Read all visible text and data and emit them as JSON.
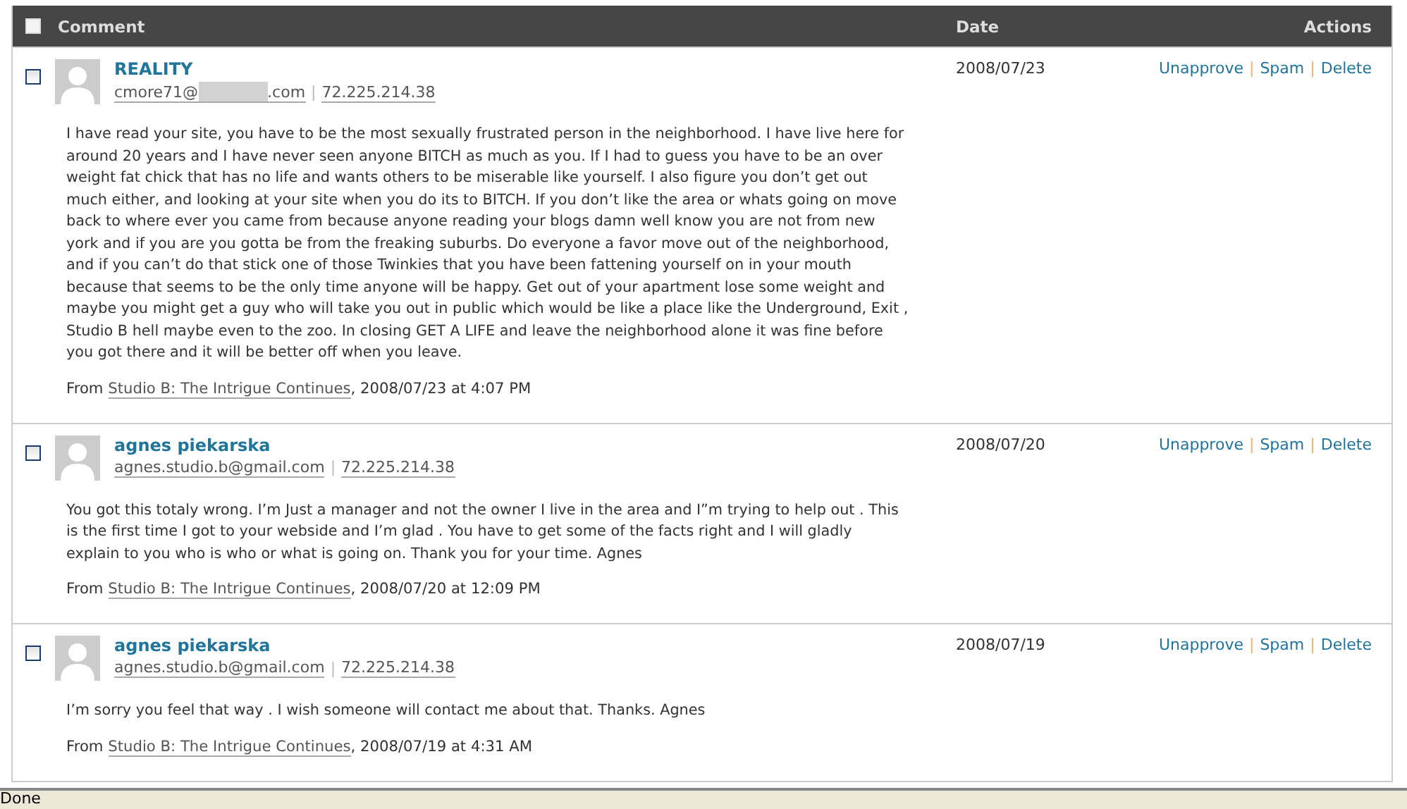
{
  "table": {
    "select_all": {
      "checked": false
    },
    "columns": [
      "Comment",
      "Date",
      "Actions"
    ],
    "rows": [
      {
        "checked": false,
        "author": "REALITY",
        "contact": {
          "email_start": "cmore71@",
          "email_redacted": true,
          "email_end": ".com",
          "separator": "|",
          "ip": "72.225.214.38"
        },
        "body": "I have read your site, you have to be the most sexually frustrated person in the neighborhood. I have live here for around 20 years and I have never seen anyone BITCH as much as you. If I had to guess you have to be an over weight fat chick that has no life and wants others to be miserable like yourself. I also figure you don’t get out much either, and looking at your site when you do its to BITCH. If you don’t like the area or whats going on move back to where ever you came from because anyone reading your blogs damn well know you are not from new york and if you are you gotta be from the freaking suburbs. Do everyone a favor move out of the neighborhood, and if you can’t do that stick one of those Twinkies that you have been fattening yourself on in your mouth because that seems to be the only time anyone will be happy. Get out of your apartment lose some weight and maybe you might get a guy who will take you out in public which would be like a place like the Underground, Exit , Studio B hell maybe even to the zoo. In closing GET A LIFE and leave the neighborhood alone it was fine before you got there and it will be better off when you leave.",
        "from_label": "From",
        "post": "Studio B: The Intrigue Continues",
        "posted": ", 2008/07/23 at 4:07 PM",
        "date": "2008/07/23",
        "actions": [
          "Unapprove",
          "Spam",
          "Delete"
        ],
        "action_separators": [
          "|",
          "|"
        ]
      },
      {
        "checked": false,
        "author": "agnes piekarska",
        "contact": {
          "email_start": "agnes.studio.b@gmail.com",
          "email_redacted": false,
          "separator": "|",
          "ip": "72.225.214.38"
        },
        "body": "You got this totaly wrong. I’m Just a manager and not the owner I live in the area and I”m trying to help out . This is the first time I got to your webside and I’m glad . You have to get some of the facts right and I will gladly explain to you who is who or what is going on. Thank you for your time. Agnes",
        "from_label": "From",
        "post": "Studio B: The Intrigue Continues",
        "posted": ", 2008/07/20 at 12:09 PM",
        "date": "2008/07/20",
        "actions": [
          "Unapprove",
          "Spam",
          "Delete"
        ],
        "action_separators": [
          "|",
          "|"
        ]
      },
      {
        "checked": false,
        "author": "agnes piekarska",
        "contact": {
          "email_start": "agnes.studio.b@gmail.com",
          "email_redacted": false,
          "separator": "|",
          "ip": "72.225.214.38"
        },
        "body": "I’m sorry you feel that way . I wish someone will contact me about that. Thanks. Agnes",
        "from_label": "From",
        "post": "Studio B: The Intrigue Continues",
        "posted": ", 2008/07/19 at 4:31 AM",
        "date": "2008/07/19",
        "actions": [
          "Unapprove",
          "Spam",
          "Delete"
        ],
        "action_separators": [
          "|",
          "|"
        ]
      }
    ]
  },
  "status_bar": {
    "text": "Done"
  }
}
